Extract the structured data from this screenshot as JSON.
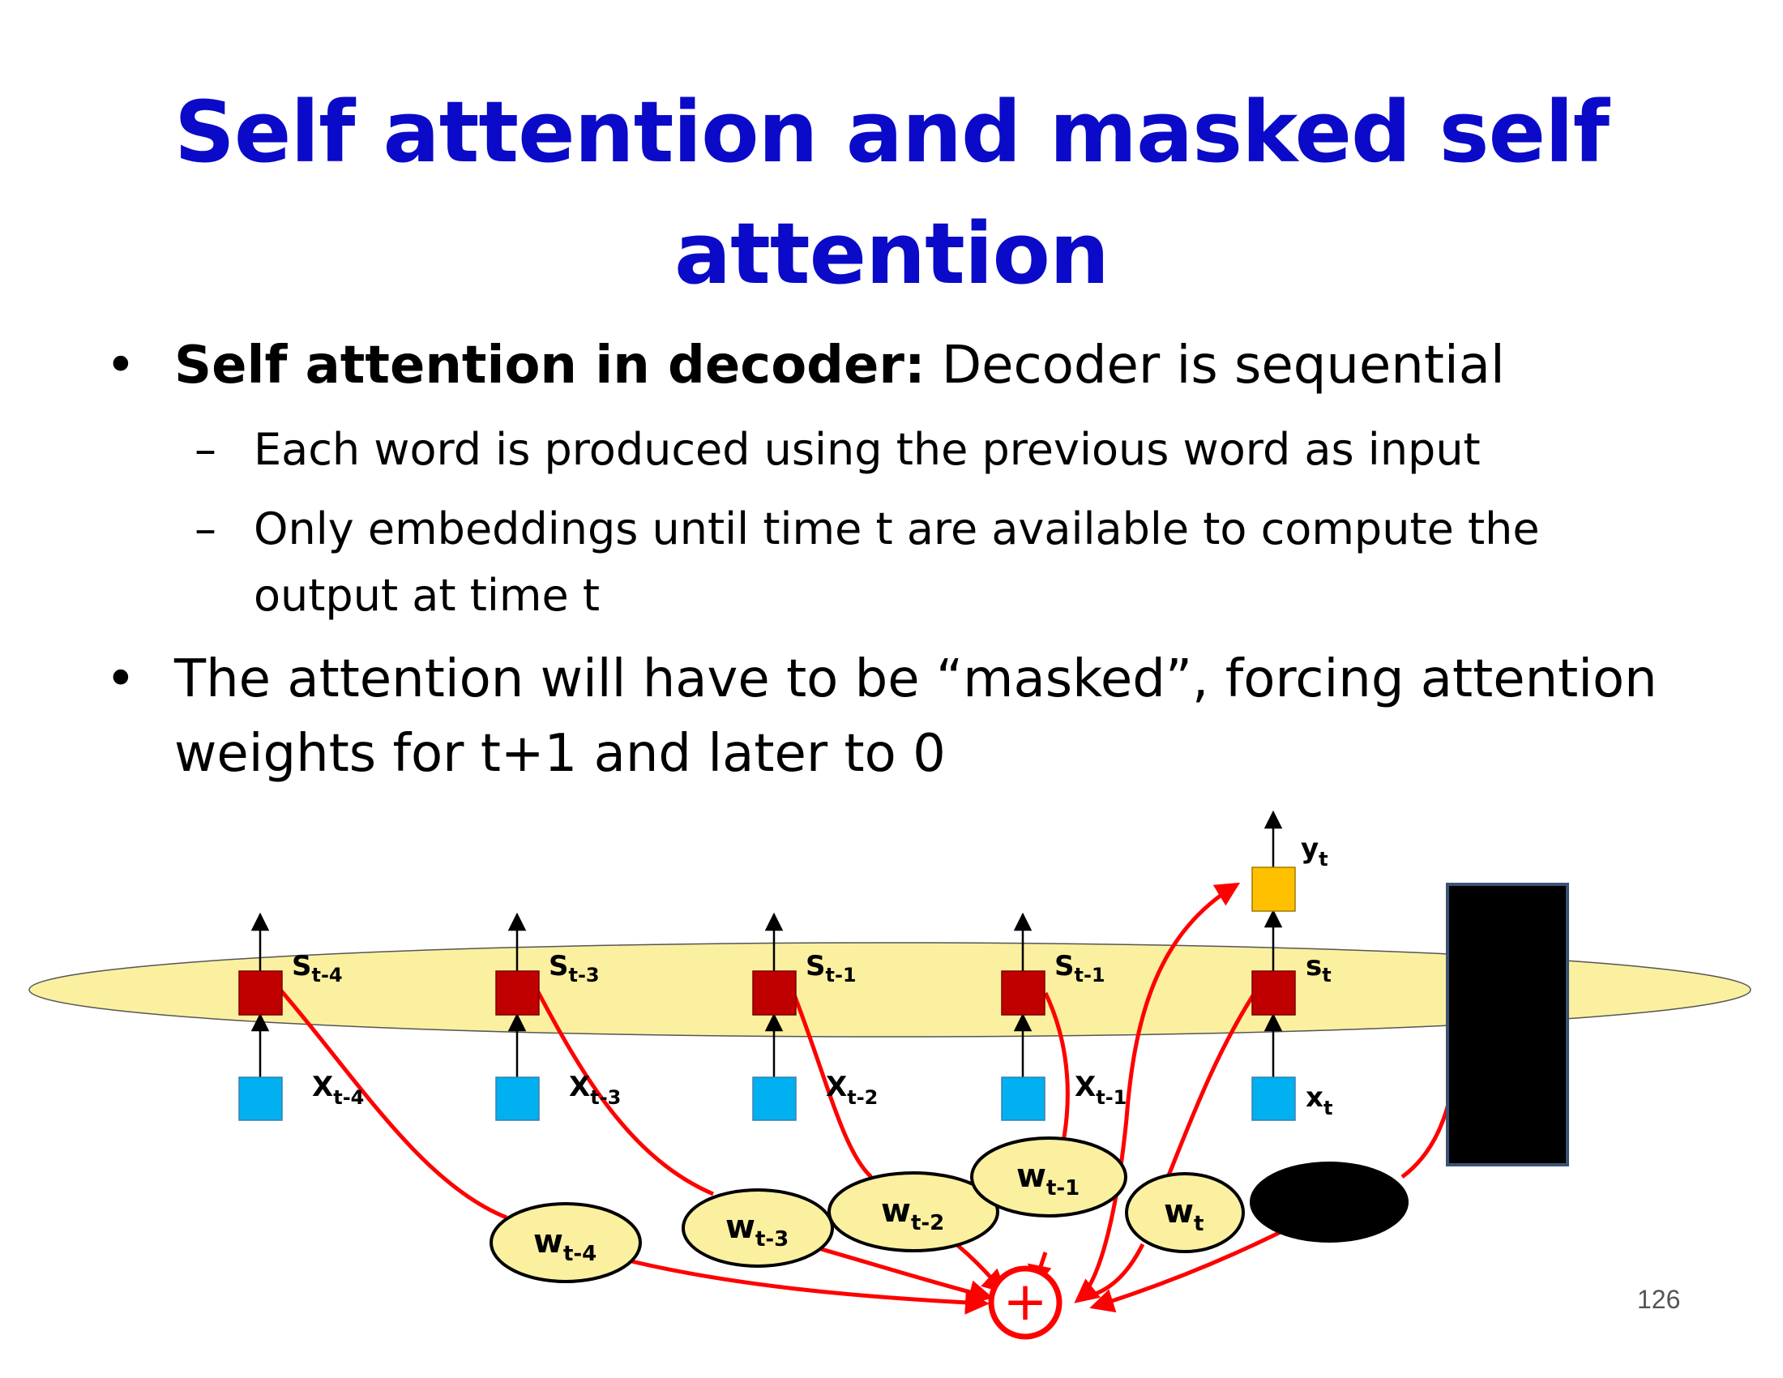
{
  "slide": {
    "title_line1": "Self attention and masked self",
    "title_line2": "attention",
    "bullet1_bold": "Self attention in decoder:",
    "bullet1_rest": " Decoder is sequential",
    "sub1": "Each word is produced using the previous word as input",
    "sub2_line1": "Only embeddings until time t are available to compute the",
    "sub2_line2": "output at time t",
    "bullet2_line1": "The attention will have to be “masked”, forcing attention",
    "bullet2_line2": "weights for t+1 and later to 0",
    "page_number": "126"
  },
  "diagram": {
    "states": [
      {
        "base": "S",
        "sub": "t-4"
      },
      {
        "base": "S",
        "sub": "t-3"
      },
      {
        "base": "S",
        "sub": "t-1"
      },
      {
        "base": "S",
        "sub": "t-1"
      },
      {
        "base": "s",
        "sub": "t"
      }
    ],
    "inputs": [
      {
        "base": "X",
        "sub": "t-4"
      },
      {
        "base": "X",
        "sub": "t-3"
      },
      {
        "base": "X",
        "sub": "t-2"
      },
      {
        "base": "X",
        "sub": "t-1"
      },
      {
        "base": "x",
        "sub": "t"
      }
    ],
    "weights": [
      {
        "base": "w",
        "sub": "t-4"
      },
      {
        "base": "w",
        "sub": "t-3"
      },
      {
        "base": "w",
        "sub": "t-2"
      },
      {
        "base": "w",
        "sub": "t-1"
      },
      {
        "base": "w",
        "sub": "t"
      }
    ],
    "output": {
      "base": "y",
      "sub": "t"
    },
    "sum_symbol": "+",
    "colors": {
      "state": "#c00000",
      "input": "#00b0f0",
      "output": "#ffc000",
      "ellipse_fill": "#fbf0a0",
      "arrow": "#ff0000",
      "title": "#0a0ac8",
      "mask": "#000000"
    }
  }
}
